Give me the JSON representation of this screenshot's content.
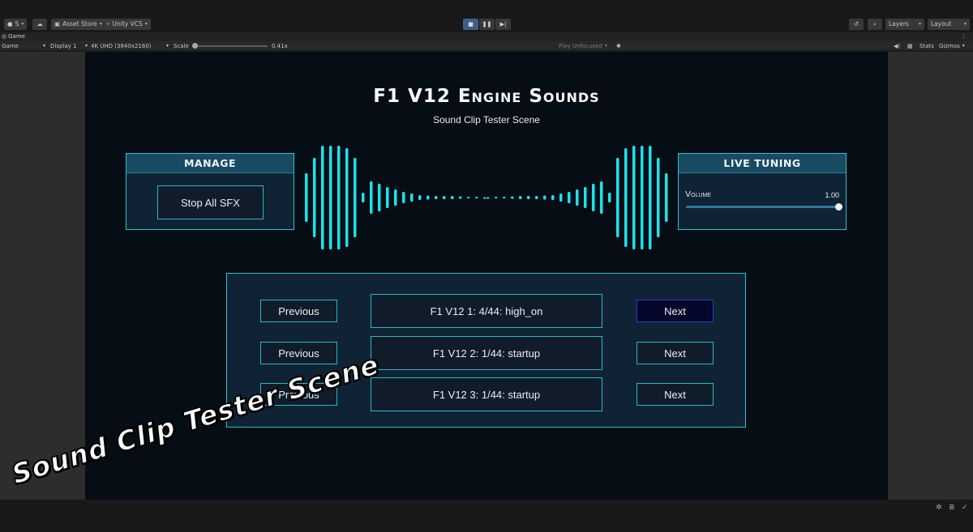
{
  "toolbar": {
    "account_label": "S",
    "asset_store_label": "Asset Store",
    "vcs_label": "Unity VCS",
    "layers_label": "Layers",
    "layout_label": "Layout"
  },
  "tab": {
    "label": "Game"
  },
  "gamebar": {
    "mode": "Game",
    "display": "Display 1",
    "resolution": "4K UHD (3840x2160)",
    "scale_label": "Scale",
    "scale_value": "0.41x",
    "play_focus": "Play Unfocused",
    "stats_label": "Stats",
    "gizmos_label": "Gizmos"
  },
  "game": {
    "title": "F1 V12 Engine Sounds",
    "subtitle": "Sound Clip Tester Scene",
    "manage": {
      "header": "MANAGE",
      "stop_label": "Stop All SFX"
    },
    "tuning": {
      "header": "LIVE TUNING",
      "volume_label": "Volume",
      "volume_value": "1.00",
      "volume_fraction": 1.0
    },
    "clips": [
      {
        "prev": "Previous",
        "name": "F1 V12 1: 4/44: high_on",
        "next": "Next"
      },
      {
        "prev": "Previous",
        "name": "F1 V12 2: 1/44: startup",
        "next": "Next"
      },
      {
        "prev": "Previous",
        "name": "F1 V12 3: 1/44: startup",
        "next": "Next"
      }
    ],
    "accent_color": "#25c4d4",
    "wave_color": "#19e3ec"
  },
  "overlay_caption": "Sound Clip Tester Scene"
}
